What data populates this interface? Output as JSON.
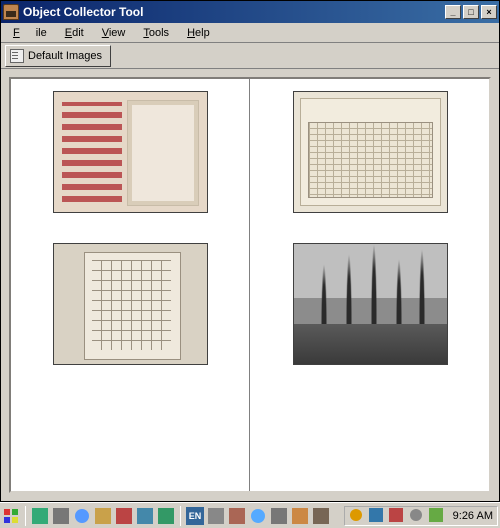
{
  "window": {
    "title": "Object Collector Tool"
  },
  "window_controls": {
    "minimize": "_",
    "maximize": "□",
    "close": "×"
  },
  "menu": {
    "file": "File",
    "edit": "Edit",
    "view": "View",
    "tools": "Tools",
    "help": "Help"
  },
  "toolbar": {
    "default_images_label": "Default Images"
  },
  "taskbar": {
    "clock": "9:26 AM",
    "lang": "EN"
  }
}
